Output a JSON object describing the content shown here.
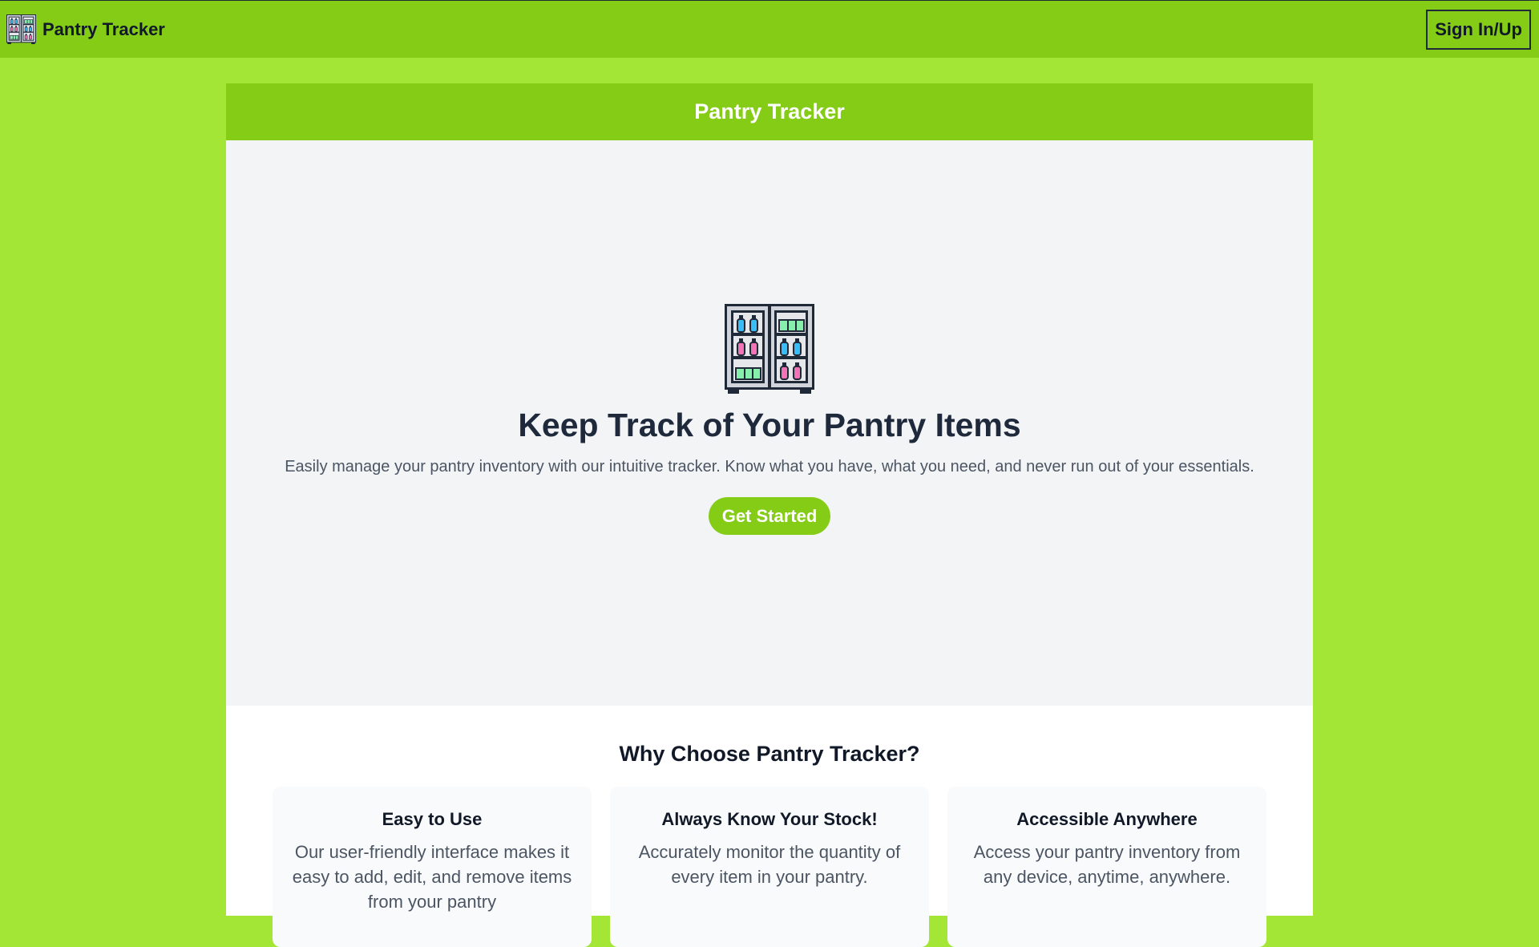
{
  "navbar": {
    "brand_name": "Pantry Tracker",
    "logo_icon": "pantry-cabinet-icon",
    "signin_label": "Sign In/Up"
  },
  "header": {
    "title": "Pantry Tracker"
  },
  "hero": {
    "icon": "pantry-cabinet-icon",
    "title": "Keep Track of Your Pantry Items",
    "subtitle": "Easily manage your pantry inventory with our intuitive tracker. Know what you have, what you need, and never run out of your essentials.",
    "cta_label": "Get Started"
  },
  "features": {
    "title": "Why Choose Pantry Tracker?",
    "items": [
      {
        "title": "Easy to Use",
        "description": "Our user-friendly interface makes it easy to add, edit, and remove items from your pantry"
      },
      {
        "title": "Always Know Your Stock!",
        "description": "Accurately monitor the quantity of every item in your pantry."
      },
      {
        "title": "Accessible Anywhere",
        "description": "Access your pantry inventory from any device, anytime, anywhere."
      }
    ]
  },
  "colors": {
    "page_background": "#a3e635",
    "brand_green": "#84cc16",
    "hero_background": "#f3f4f6",
    "heading_dark": "#1e293b"
  }
}
